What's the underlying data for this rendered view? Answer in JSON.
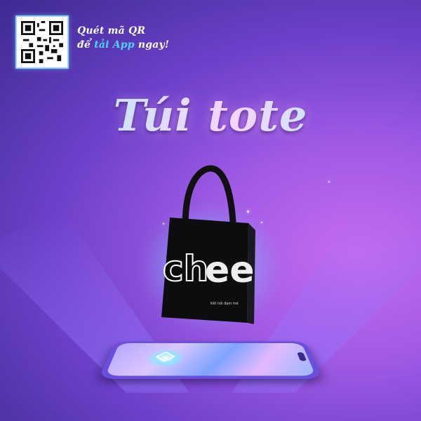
{
  "qr": {
    "icon": "qr-code-icon"
  },
  "cta": {
    "line1": "Quét mã QR",
    "line2_prefix": "để",
    "line2_highlight": "tải App",
    "line2_suffix": "ngay!"
  },
  "title": "Túi tote",
  "bag": {
    "print_text": "chee",
    "small_text": "Kết nối đam mê"
  },
  "colors": {
    "accent_cyan": "#4fd3ff",
    "bg_dark": "#3d2a8f",
    "bg_light": "#c46cf0"
  },
  "icons": [
    "qr-code-icon",
    "app-logo-icon",
    "tote-bag-icon",
    "phone-icon"
  ]
}
